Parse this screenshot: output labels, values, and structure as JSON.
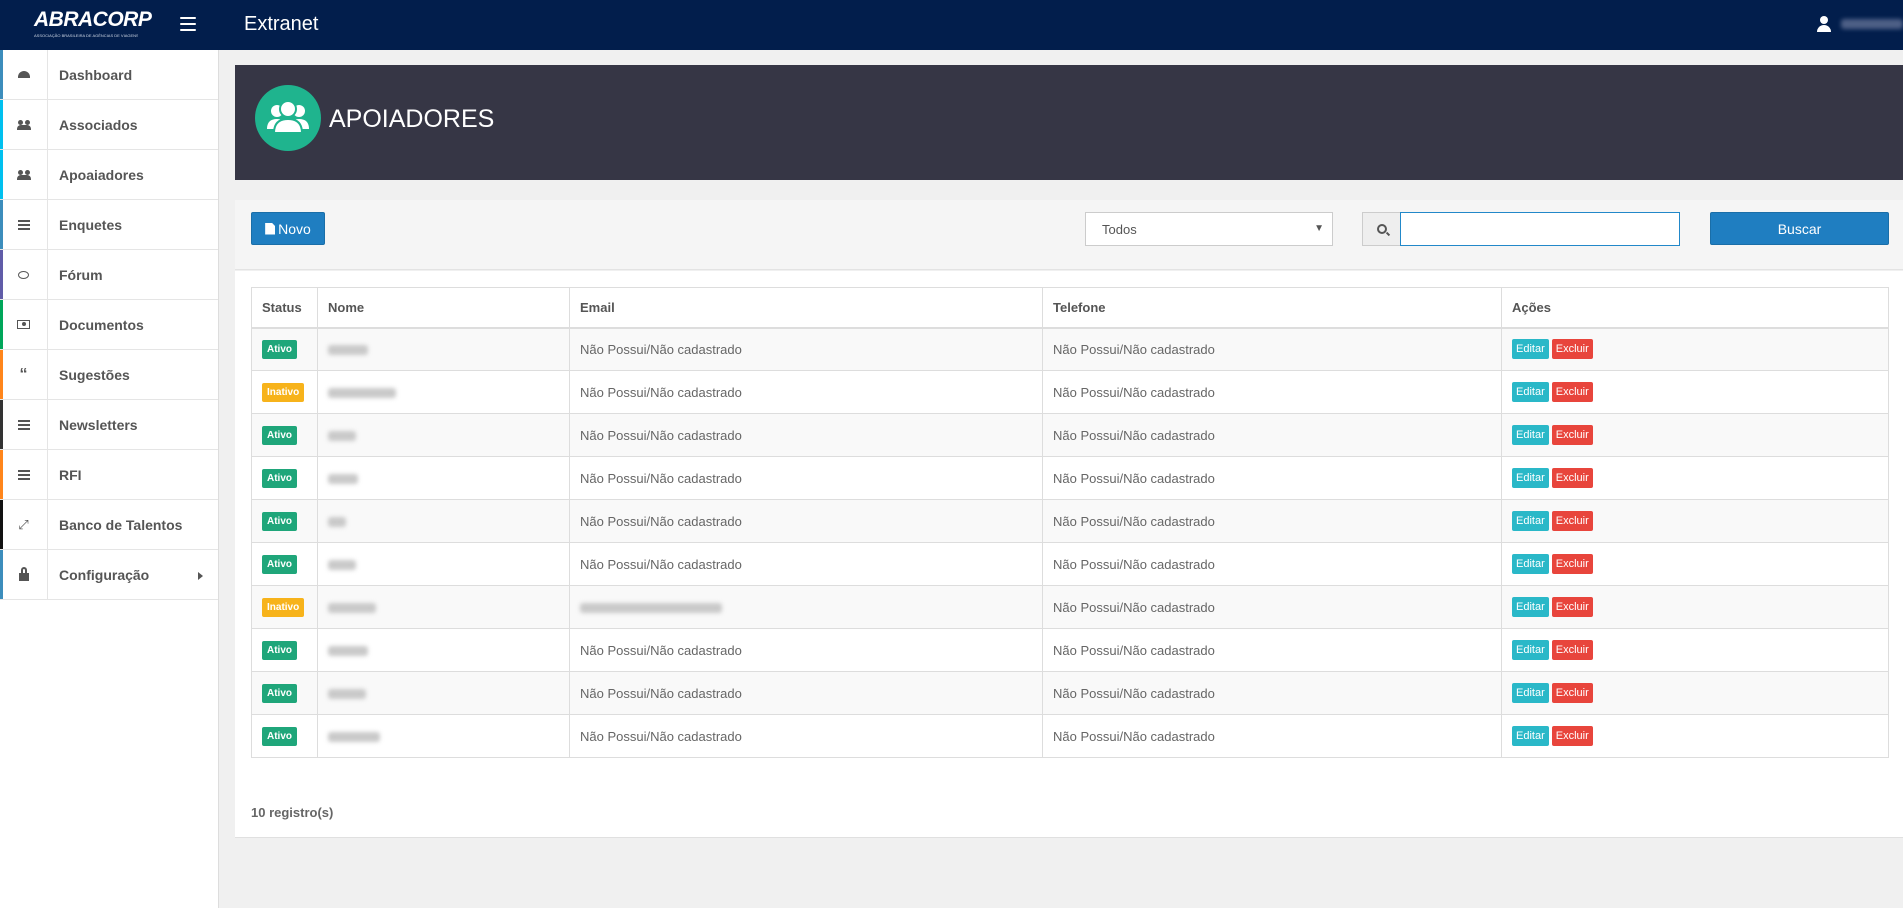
{
  "topbar": {
    "logo_text": "ABRACORP",
    "logo_subtitle": "ASSOCIAÇÃO BRASILEIRA DE AGÊNCIAS DE VIAGENS CORPORATIVAS",
    "title": "Extranet",
    "user_icon": "user-icon"
  },
  "sidebar": {
    "items": [
      {
        "label": "Dashboard",
        "icon": "dashboard-icon",
        "color": "#3c8dbc"
      },
      {
        "label": "Associados",
        "icon": "users-icon",
        "color": "#00c0ef"
      },
      {
        "label": "Apoaiadores",
        "icon": "users-icon",
        "color": "#00c0ef"
      },
      {
        "label": "Enquetes",
        "icon": "list-icon",
        "color": "#3c8dbc"
      },
      {
        "label": "Fórum",
        "icon": "comment-icon",
        "color": "#605ca8"
      },
      {
        "label": "Documentos",
        "icon": "money-icon",
        "color": "#00a65a"
      },
      {
        "label": "Sugestões",
        "icon": "quote-icon",
        "color": "#ff851b"
      },
      {
        "label": "Newsletters",
        "icon": "list-icon",
        "color": "#333333"
      },
      {
        "label": "RFI",
        "icon": "list-icon",
        "color": "#ff851b"
      },
      {
        "label": "Banco de Talentos",
        "icon": "compress-icon",
        "color": "#111111"
      },
      {
        "label": "Configuração",
        "icon": "lock-icon",
        "color": "#3c8dbc"
      }
    ]
  },
  "page": {
    "title": "APOIADORES",
    "header_icon": "users-icon"
  },
  "toolbar": {
    "new_label": "Novo",
    "filter_value": "Todos",
    "search_value": "",
    "search_button_label": "Buscar"
  },
  "table": {
    "headers": [
      "Status",
      "Nome",
      "Email",
      "Telefone",
      "Ações"
    ],
    "edit_label": "Editar",
    "delete_label": "Excluir",
    "rows": [
      {
        "status": "Ativo",
        "email": "Não Possui/Não cadastrado",
        "phone": "Não Possui/Não cadastrado"
      },
      {
        "status": "Inativo",
        "email": "Não Possui/Não cadastrado",
        "phone": "Não Possui/Não cadastrado"
      },
      {
        "status": "Ativo",
        "email": "Não Possui/Não cadastrado",
        "phone": "Não Possui/Não cadastrado"
      },
      {
        "status": "Ativo",
        "email": "Não Possui/Não cadastrado",
        "phone": "Não Possui/Não cadastrado"
      },
      {
        "status": "Ativo",
        "email": "Não Possui/Não cadastrado",
        "phone": "Não Possui/Não cadastrado"
      },
      {
        "status": "Ativo",
        "email": "Não Possui/Não cadastrado",
        "phone": "Não Possui/Não cadastrado"
      },
      {
        "status": "Inativo",
        "email": "",
        "phone": "Não Possui/Não cadastrado"
      },
      {
        "status": "Ativo",
        "email": "Não Possui/Não cadastrado",
        "phone": "Não Possui/Não cadastrado"
      },
      {
        "status": "Ativo",
        "email": "Não Possui/Não cadastrado",
        "phone": "Não Possui/Não cadastrado"
      },
      {
        "status": "Ativo",
        "email": "Não Possui/Não cadastrado",
        "phone": "Não Possui/Não cadastrado"
      }
    ],
    "records_label": "10 registro(s)"
  },
  "colors": {
    "topbar": "#021e4c",
    "header": "#363645",
    "accent": "#1f7ec1",
    "active": "#1fa67a",
    "inactive": "#f7b31b",
    "edit": "#2ab8c8",
    "delete": "#e8453c"
  }
}
